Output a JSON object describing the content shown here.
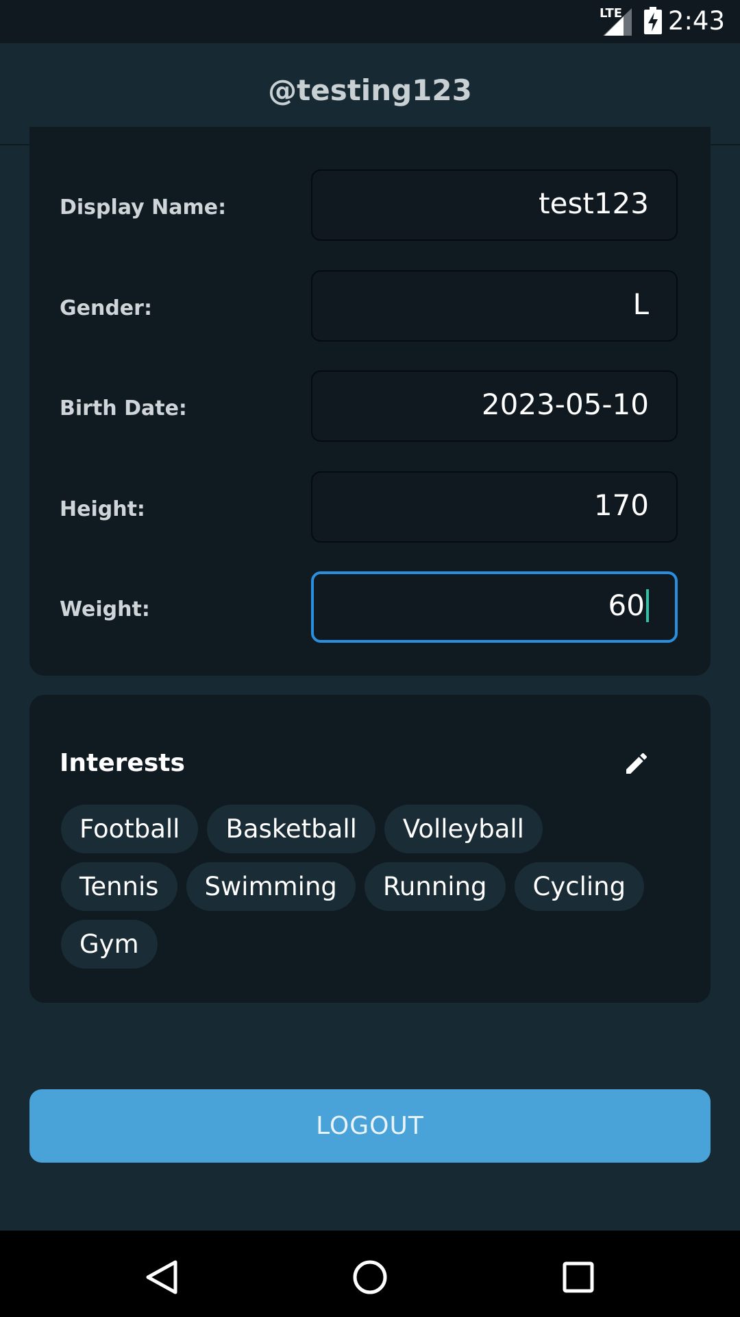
{
  "status_bar": {
    "time": "2:43",
    "network": "LTE",
    "icons": [
      "signal-icon",
      "battery-charging-icon"
    ]
  },
  "app_bar": {
    "title": "@testing123"
  },
  "profile": {
    "fields": [
      {
        "label": "Display Name:",
        "value": "test123"
      },
      {
        "label": "Gender:",
        "value": "L"
      },
      {
        "label": "Birth Date:",
        "value": "2023-05-10"
      },
      {
        "label": "Height:",
        "value": "170"
      },
      {
        "label": "Weight:",
        "value": "60"
      }
    ]
  },
  "interests": {
    "title": "Interests",
    "edit_icon": "pencil-edit-icon",
    "tags": [
      "Football",
      "Basketball",
      "Volleyball",
      "Tennis",
      "Swimming",
      "Running",
      "Cycling",
      "Gym"
    ]
  },
  "logout_label": "LOGOUT",
  "nav_bar": {
    "icons": [
      "back-icon",
      "home-icon",
      "recents-icon"
    ]
  },
  "colors": {
    "background": "#172a33",
    "card": "#101a21",
    "accent": "#4aa3d8",
    "focus_border": "#2b8fdf",
    "cursor": "#2ec4a8"
  }
}
